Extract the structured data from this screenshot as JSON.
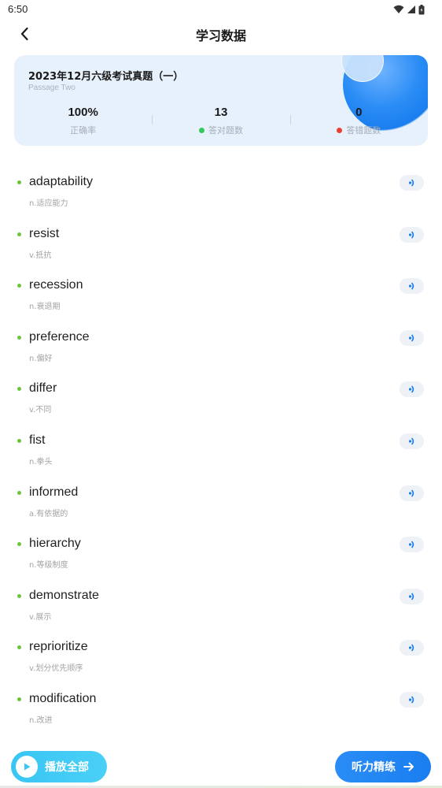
{
  "status_bar": {
    "time": "6:50",
    "icons": [
      "wifi-icon",
      "signal-icon",
      "battery-icon"
    ]
  },
  "nav": {
    "back_icon": "chevron-left-icon",
    "title": "学习数据"
  },
  "summary": {
    "title": "2023年12月六级考试真题（一）",
    "subtitle": "Passage Two",
    "stats": [
      {
        "value": "100%",
        "label": "正确率"
      },
      {
        "value": "13",
        "label": "答对题数",
        "dot_color": "#34c759"
      },
      {
        "value": "0",
        "label": "答错题数",
        "dot_color": "#e8422e"
      }
    ]
  },
  "words": [
    {
      "word": "adaptability",
      "meaning": "n.适应能力"
    },
    {
      "word": "resist",
      "meaning": "v.抵抗"
    },
    {
      "word": "recession",
      "meaning": "n.衰退期"
    },
    {
      "word": "preference",
      "meaning": "n.偏好"
    },
    {
      "word": "differ",
      "meaning": "v.不同"
    },
    {
      "word": "fist",
      "meaning": "n.拳头"
    },
    {
      "word": "informed",
      "meaning": "a.有依据的"
    },
    {
      "word": "hierarchy",
      "meaning": "n.等级制度"
    },
    {
      "word": "demonstrate",
      "meaning": "v.展示"
    },
    {
      "word": "reprioritize",
      "meaning": "v.划分优先顺序"
    },
    {
      "word": "modification",
      "meaning": "n.改进"
    }
  ],
  "bottom": {
    "play_all_label": "播放全部",
    "listen_label": "听力精练"
  },
  "colors": {
    "accent": "#1a7ef0",
    "play_gradient": "#39c6f4",
    "bullet": "#6bc43a",
    "correct": "#34c759",
    "wrong": "#e8422e"
  }
}
